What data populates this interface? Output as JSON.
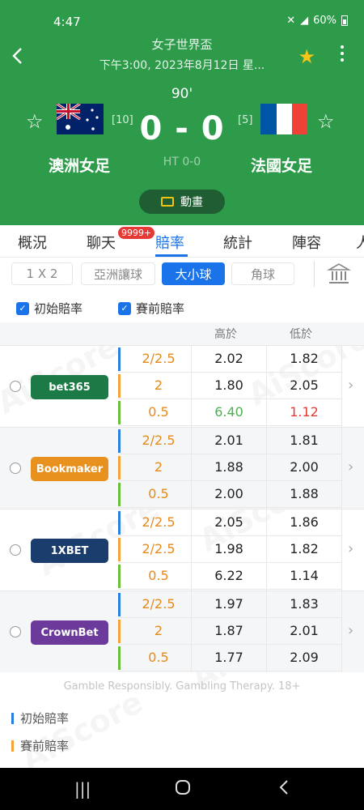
{
  "status_bar": {
    "time": "4:47",
    "battery": "60%"
  },
  "header": {
    "title": "女子世界盃",
    "subtitle": "下午3:00, 2023年8月12日 星...",
    "minute": "90'",
    "score": "0 - 0",
    "halftime": "HT 0-0",
    "home": {
      "name": "澳洲女足",
      "rank": "[10]"
    },
    "away": {
      "name": "法國女足",
      "rank": "[5]"
    },
    "animation_label": "動畫"
  },
  "tabs": {
    "items": [
      "概況",
      "聊天",
      "賠率",
      "統計",
      "陣容",
      "人"
    ],
    "active": "賠率",
    "chat_badge": "9999+"
  },
  "market_tabs": {
    "items": [
      "1 X 2",
      "亞洲讓球",
      "大小球",
      "角球"
    ],
    "active": "大小球"
  },
  "filters": {
    "initial": "初始賠率",
    "pregame": "賽前賠率"
  },
  "columns": {
    "over": "高於",
    "under": "低於"
  },
  "bookmakers": [
    {
      "name": "bet365",
      "color": "#1b7a45",
      "rows": [
        {
          "line": "2/2.5",
          "over": "2.02",
          "under": "1.82"
        },
        {
          "line": "2",
          "over": "1.80",
          "under": "2.05"
        },
        {
          "line": "0.5",
          "over": "6.40",
          "under": "1.12"
        }
      ]
    },
    {
      "name": "Bookmaker",
      "color": "#e8911e",
      "rows": [
        {
          "line": "2/2.5",
          "over": "2.01",
          "under": "1.81"
        },
        {
          "line": "2",
          "over": "1.88",
          "under": "2.00"
        },
        {
          "line": "0.5",
          "over": "2.00",
          "under": "1.88"
        }
      ]
    },
    {
      "name": "1XBET",
      "color": "#1b3d6d",
      "rows": [
        {
          "line": "2/2.5",
          "over": "2.05",
          "under": "1.86"
        },
        {
          "line": "2/2.5",
          "over": "1.98",
          "under": "1.82"
        },
        {
          "line": "0.5",
          "over": "6.22",
          "under": "1.14"
        }
      ]
    },
    {
      "name": "CrownBet",
      "color": "#6b3a9a",
      "rows": [
        {
          "line": "2/2.5",
          "over": "1.97",
          "under": "1.83"
        },
        {
          "line": "2",
          "over": "1.87",
          "under": "2.01"
        },
        {
          "line": "0.5",
          "over": "1.77",
          "under": "2.09"
        }
      ]
    }
  ],
  "row_bar_colors": [
    "#2b7fe0",
    "#f2a33a",
    "#6cbf3a"
  ],
  "disclaimer": "Gamble Responsibly. Gambling Therapy. 18+",
  "legend": [
    {
      "label": "初始賠率",
      "color": "#2b7fe0"
    },
    {
      "label": "賽前賠率",
      "color": "#f2a33a"
    }
  ],
  "watermark": "AiScore"
}
